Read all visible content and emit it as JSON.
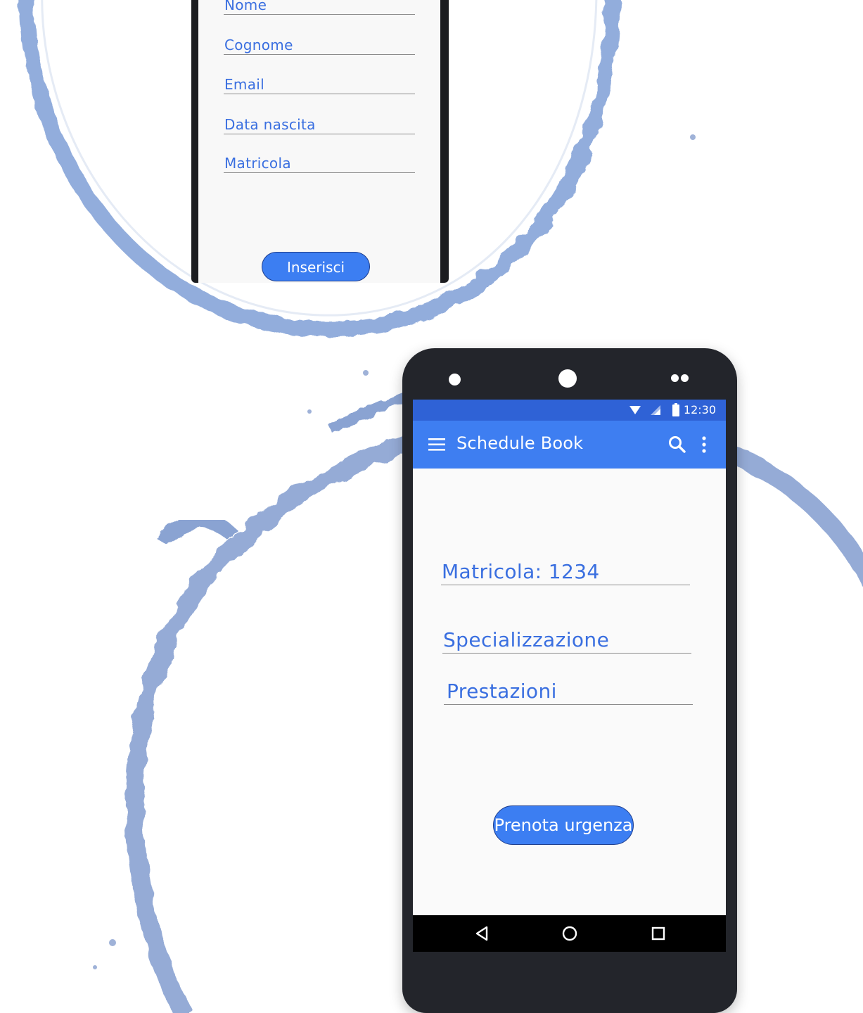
{
  "registration_form": {
    "fields": [
      {
        "label": "Nome"
      },
      {
        "label": "Cognome"
      },
      {
        "label": "Email"
      },
      {
        "label": "Data nascita"
      },
      {
        "label": "Matricola"
      }
    ],
    "submit_label": "Inserisci"
  },
  "status_bar": {
    "time": "12:30",
    "icons": [
      "wifi-icon",
      "signal-icon",
      "battery-icon"
    ]
  },
  "app_bar": {
    "title": "Schedule Book",
    "icons": [
      "menu-icon",
      "search-icon",
      "more-vert-icon"
    ]
  },
  "booking_form": {
    "matricola": "Matricola: 1234",
    "specializzazione": "Specializzazione",
    "prestazioni": "Prestazioni",
    "action_label": "Prenota urgenza"
  },
  "navigation_bar": {
    "icons": [
      "back-icon",
      "home-icon",
      "recents-icon"
    ]
  },
  "colors": {
    "app_bar": "#3e7ef1",
    "status_bar": "#2f62d6",
    "button": "#3c7ef2",
    "label_text": "#3a6fe0",
    "phone_body": "#23252b",
    "watercolor_ring": "#7f9fd6"
  }
}
